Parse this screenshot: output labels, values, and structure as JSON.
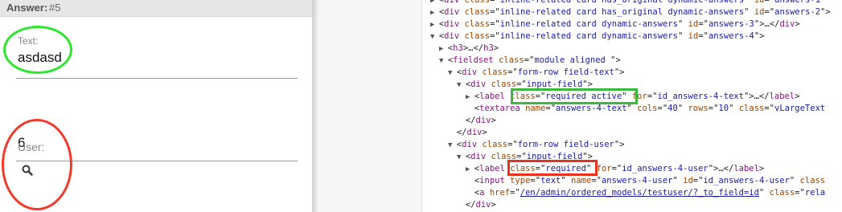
{
  "left_panel": {
    "header_label": "Answer:",
    "header_number": "#5",
    "text_field": {
      "label": "Text:",
      "value": "asdasd"
    },
    "user_field": {
      "label": "User:",
      "value": "6"
    },
    "annotation_colors": {
      "green": "#2ee62e",
      "red": "#f03a2c"
    },
    "icons": [
      "search-icon"
    ]
  },
  "devtools": {
    "lines": [
      {
        "indent": 0,
        "tri": "▶",
        "parts": [
          [
            "p",
            "<"
          ],
          [
            "t",
            "div"
          ],
          [
            "p",
            " "
          ],
          [
            "a",
            "class"
          ],
          [
            "p",
            "=\""
          ],
          [
            "v",
            "inline-related card has_original dynamic-answers"
          ],
          [
            "p",
            "\" "
          ],
          [
            "a",
            "id"
          ],
          [
            "p",
            "=\""
          ],
          [
            "v",
            "answers-1"
          ],
          [
            "p",
            "\""
          ]
        ]
      },
      {
        "indent": 0,
        "tri": "▶",
        "parts": [
          [
            "p",
            "<"
          ],
          [
            "t",
            "div"
          ],
          [
            "p",
            " "
          ],
          [
            "a",
            "class"
          ],
          [
            "p",
            "=\""
          ],
          [
            "v",
            "inline-related card has_original dynamic-answers"
          ],
          [
            "p",
            "\" "
          ],
          [
            "a",
            "id"
          ],
          [
            "p",
            "=\""
          ],
          [
            "v",
            "answers-2"
          ],
          [
            "p",
            "\">"
          ]
        ]
      },
      {
        "indent": 0,
        "tri": "▶",
        "parts": [
          [
            "p",
            "<"
          ],
          [
            "t",
            "div"
          ],
          [
            "p",
            " "
          ],
          [
            "a",
            "class"
          ],
          [
            "p",
            "=\""
          ],
          [
            "v",
            "inline-related card dynamic-answers"
          ],
          [
            "p",
            "\" "
          ],
          [
            "a",
            "id"
          ],
          [
            "p",
            "=\""
          ],
          [
            "v",
            "answers-3"
          ],
          [
            "p",
            "\">…</"
          ],
          [
            "t",
            "div"
          ],
          [
            "p",
            ">"
          ]
        ]
      },
      {
        "indent": 0,
        "tri": "▼",
        "parts": [
          [
            "p",
            "<"
          ],
          [
            "t",
            "div"
          ],
          [
            "p",
            " "
          ],
          [
            "a",
            "class"
          ],
          [
            "p",
            "=\""
          ],
          [
            "v",
            "inline-related card dynamic-answers"
          ],
          [
            "p",
            "\" "
          ],
          [
            "a",
            "id"
          ],
          [
            "p",
            "=\""
          ],
          [
            "v",
            "answers-4"
          ],
          [
            "p",
            "\">"
          ]
        ]
      },
      {
        "indent": 1,
        "tri": "▶",
        "parts": [
          [
            "p",
            "<"
          ],
          [
            "t",
            "h3"
          ],
          [
            "p",
            ">…</"
          ],
          [
            "t",
            "h3"
          ],
          [
            "p",
            ">"
          ]
        ]
      },
      {
        "indent": 1,
        "tri": "▼",
        "parts": [
          [
            "p",
            "<"
          ],
          [
            "t",
            "fieldset"
          ],
          [
            "p",
            " "
          ],
          [
            "a",
            "class"
          ],
          [
            "p",
            "=\""
          ],
          [
            "v",
            "module aligned "
          ],
          [
            "p",
            "\">"
          ]
        ]
      },
      {
        "indent": 2,
        "tri": "▼",
        "parts": [
          [
            "p",
            "<"
          ],
          [
            "t",
            "div"
          ],
          [
            "p",
            " "
          ],
          [
            "a",
            "class"
          ],
          [
            "p",
            "=\""
          ],
          [
            "v",
            "form-row field-text"
          ],
          [
            "p",
            "\">"
          ]
        ]
      },
      {
        "indent": 3,
        "tri": "▼",
        "parts": [
          [
            "p",
            "<"
          ],
          [
            "t",
            "div"
          ],
          [
            "p",
            " "
          ],
          [
            "a",
            "class"
          ],
          [
            "p",
            "=\""
          ],
          [
            "v",
            "input-field"
          ],
          [
            "p",
            "\">"
          ]
        ]
      },
      {
        "indent": 4,
        "tri": "▶",
        "parts": [
          [
            "p",
            "<"
          ],
          [
            "t",
            "label"
          ],
          [
            "p",
            " "
          ],
          [
            "a",
            "class"
          ],
          [
            "p",
            "=\""
          ],
          [
            "v",
            "required active"
          ],
          [
            "p",
            "\" "
          ],
          [
            "a",
            "for"
          ],
          [
            "p",
            "=\""
          ],
          [
            "v",
            "id_answers-4-text"
          ],
          [
            "p",
            "\">…</"
          ],
          [
            "t",
            "label"
          ],
          [
            "p",
            ">"
          ]
        ]
      },
      {
        "indent": 4,
        "tri": "",
        "parts": [
          [
            "p",
            "<"
          ],
          [
            "t",
            "textarea"
          ],
          [
            "p",
            " "
          ],
          [
            "a",
            "name"
          ],
          [
            "p",
            "=\""
          ],
          [
            "v",
            "answers-4-text"
          ],
          [
            "p",
            "\" "
          ],
          [
            "a",
            "cols"
          ],
          [
            "p",
            "=\""
          ],
          [
            "v",
            "40"
          ],
          [
            "p",
            "\" "
          ],
          [
            "a",
            "rows"
          ],
          [
            "p",
            "=\""
          ],
          [
            "v",
            "10"
          ],
          [
            "p",
            "\" "
          ],
          [
            "a",
            "class"
          ],
          [
            "p",
            "=\""
          ],
          [
            "v",
            "vLargeText"
          ]
        ]
      },
      {
        "indent": 3,
        "tri": "",
        "parts": [
          [
            "p",
            "</"
          ],
          [
            "t",
            "div"
          ],
          [
            "p",
            ">"
          ]
        ]
      },
      {
        "indent": 2,
        "tri": "",
        "parts": [
          [
            "p",
            "</"
          ],
          [
            "t",
            "div"
          ],
          [
            "p",
            ">"
          ]
        ]
      },
      {
        "indent": 2,
        "tri": "▼",
        "parts": [
          [
            "p",
            "<"
          ],
          [
            "t",
            "div"
          ],
          [
            "p",
            " "
          ],
          [
            "a",
            "class"
          ],
          [
            "p",
            "=\""
          ],
          [
            "v",
            "form-row field-user"
          ],
          [
            "p",
            "\">"
          ]
        ]
      },
      {
        "indent": 3,
        "tri": "▼",
        "parts": [
          [
            "p",
            "<"
          ],
          [
            "t",
            "div"
          ],
          [
            "p",
            " "
          ],
          [
            "a",
            "class"
          ],
          [
            "p",
            "=\""
          ],
          [
            "v",
            "input-field"
          ],
          [
            "p",
            "\">"
          ]
        ]
      },
      {
        "indent": 4,
        "tri": "▶",
        "parts": [
          [
            "p",
            "<"
          ],
          [
            "t",
            "label"
          ],
          [
            "p",
            " "
          ],
          [
            "a",
            "class"
          ],
          [
            "p",
            "=\""
          ],
          [
            "v",
            "required"
          ],
          [
            "p",
            "\" "
          ],
          [
            "a",
            "for"
          ],
          [
            "p",
            "=\""
          ],
          [
            "v",
            "id_answers-4-user"
          ],
          [
            "p",
            "\">…</"
          ],
          [
            "t",
            "label"
          ],
          [
            "p",
            ">"
          ]
        ]
      },
      {
        "indent": 4,
        "tri": "",
        "parts": [
          [
            "p",
            "<"
          ],
          [
            "t",
            "input"
          ],
          [
            "p",
            " "
          ],
          [
            "a",
            "type"
          ],
          [
            "p",
            "=\""
          ],
          [
            "v",
            "text"
          ],
          [
            "p",
            "\" "
          ],
          [
            "a",
            "name"
          ],
          [
            "p",
            "=\""
          ],
          [
            "v",
            "answers-4-user"
          ],
          [
            "p",
            "\" "
          ],
          [
            "a",
            "id"
          ],
          [
            "p",
            "=\""
          ],
          [
            "v",
            "id_answers-4-user"
          ],
          [
            "p",
            "\" "
          ],
          [
            "a",
            "class"
          ]
        ]
      },
      {
        "indent": 4,
        "tri": "",
        "parts": [
          [
            "p",
            "<"
          ],
          [
            "t",
            "a"
          ],
          [
            "p",
            " "
          ],
          [
            "a",
            "href"
          ],
          [
            "p",
            "=\""
          ],
          [
            "l",
            "/en/admin/ordered_models/testuser/?_to_field=id"
          ],
          [
            "p",
            "\" "
          ],
          [
            "a",
            "class"
          ],
          [
            "p",
            "=\""
          ],
          [
            "v",
            "rela"
          ]
        ]
      },
      {
        "indent": 3,
        "tri": "",
        "parts": [
          [
            "p",
            "</"
          ],
          [
            "t",
            "div"
          ],
          [
            "p",
            ">"
          ]
        ]
      }
    ],
    "highlight_colors": {
      "green": "#3cb83c",
      "red": "#e8321e"
    }
  }
}
